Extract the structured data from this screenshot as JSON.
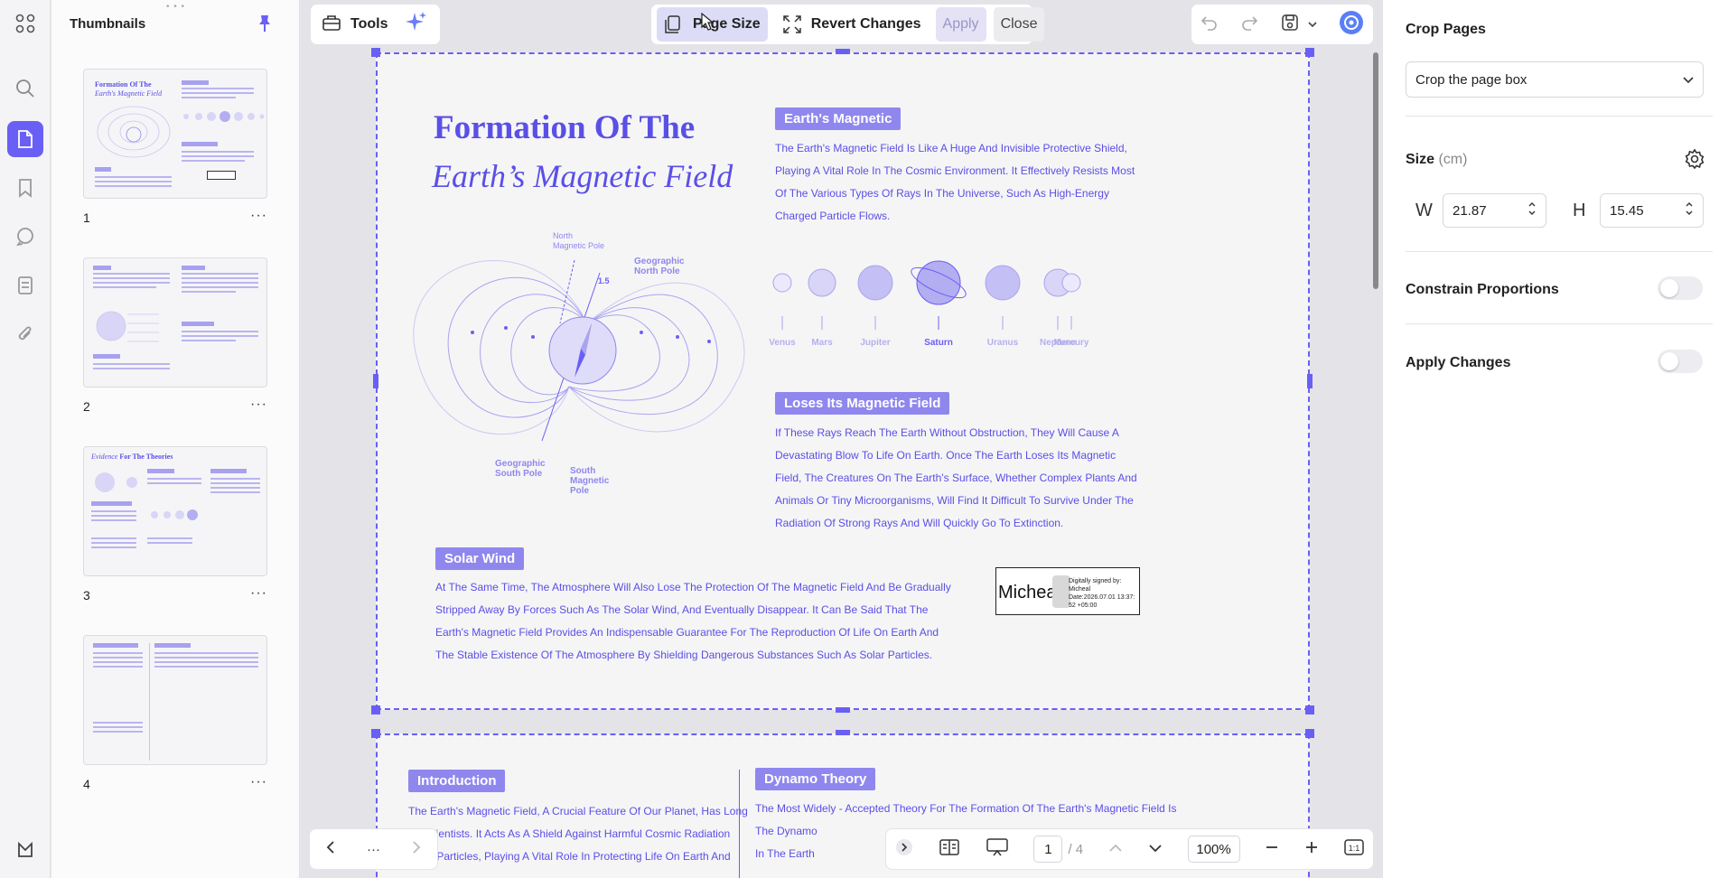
{
  "sidebar": {
    "title": "Thumbnails",
    "thumbnails": [
      {
        "number": "1",
        "more": "···"
      },
      {
        "number": "2",
        "more": "···"
      },
      {
        "number": "3",
        "more": "···"
      },
      {
        "number": "4",
        "more": "···"
      }
    ]
  },
  "toolbar": {
    "tools_label": "Tools",
    "page_size_label": "Page Size",
    "revert_label": "Revert Changes",
    "apply_label": "Apply",
    "close_label": "Close"
  },
  "page1": {
    "title_line1": "Formation Of The",
    "title_line2": "Earth’s Magnetic Field",
    "diagram_labels": {
      "north_magnetic": "North\nMagnetic Pole",
      "geographic_north": "Geographic\nNorth Pole",
      "angle": "1.5",
      "geographic_south": "Geographic\nSouth Pole",
      "south_magnetic": "South\nMagnetic\nPole"
    },
    "earths_magnetic_tag": "Earth's Magnetic",
    "earths_magnetic_text": [
      "The Earth's Magnetic Field Is Like A Huge And Invisible Protective Shield,",
      "Playing A Vital Role In The Cosmic Environment. It Effectively Resists Most",
      "Of The Various Types Of Rays In The Universe, Such As High-Energy",
      "Charged Particle Flows."
    ],
    "planets": [
      "Venus",
      "Mars",
      "Jupiter",
      "Saturn",
      "Uranus",
      "Neptune",
      "Mercury"
    ],
    "loses_tag": "Loses Its Magnetic Field",
    "loses_text": [
      "If These Rays Reach The Earth Without Obstruction, They Will Cause A",
      "Devastating Blow To Life On Earth. Once The Earth Loses Its Magnetic",
      "Field, The Creatures On The Earth's Surface, Whether Complex Plants And",
      "Animals Or Tiny Microorganisms, Will Find It Difficult To Survive Under The",
      "Radiation Of Strong Rays And Will Quickly Go To Extinction."
    ],
    "solar_tag": "Solar Wind",
    "solar_text": [
      "At The Same Time, The Atmosphere Will Also Lose The Protection Of The Magnetic Field And Be Gradually",
      "Stripped Away By Forces Such As The Solar Wind, And Eventually Disappear. It Can Be Said That The",
      "Earth's Magnetic Field Provides An Indispensable Guarantee For The Reproduction Of Life On Earth And",
      "The Stable Existence Of The Atmosphere By Shielding Dangerous Substances Such As Solar Particles."
    ],
    "signature": {
      "name": "Micheal",
      "line1": "Digitally signed by:",
      "line2": "Micheal",
      "line3": "Date:2026.07.01 13:37:",
      "line4": "52 +05:00"
    }
  },
  "page2": {
    "intro_tag": "Introduction",
    "intro_text": [
      "The Earth's Magnetic Field, A Crucial Feature Of Our Planet, Has Long",
      "ed Scientists. It Acts As A Shield Against Harmful Cosmic Radiation",
      "Solar Particles, Playing A Vital Role In Protecting Life On Earth And"
    ],
    "dynamo_tag": "Dynamo Theory",
    "dynamo_text": [
      "The Most Widely - Accepted Theory For The Formation Of The Earth's Magnetic Field Is",
      "The Dynamo",
      "In The Earth"
    ]
  },
  "bottom": {
    "current_page": "1",
    "total_pages": "/ 4",
    "zoom": "100%",
    "more": "···"
  },
  "panel": {
    "crop_title": "Crop Pages",
    "crop_select": "Crop the page box",
    "size_title": "Size",
    "size_unit": "(cm)",
    "width_label": "W",
    "width_value": "21.87",
    "height_label": "H",
    "height_value": "15.45",
    "constrain_label": "Constrain Proportions",
    "constrain_on": false,
    "apply_changes_label": "Apply Changes",
    "apply_changes_on": false
  },
  "colors": {
    "accent": "#6a5ff5",
    "page_text": "#5a4fe6",
    "tag_bg": "#8f87ee"
  }
}
